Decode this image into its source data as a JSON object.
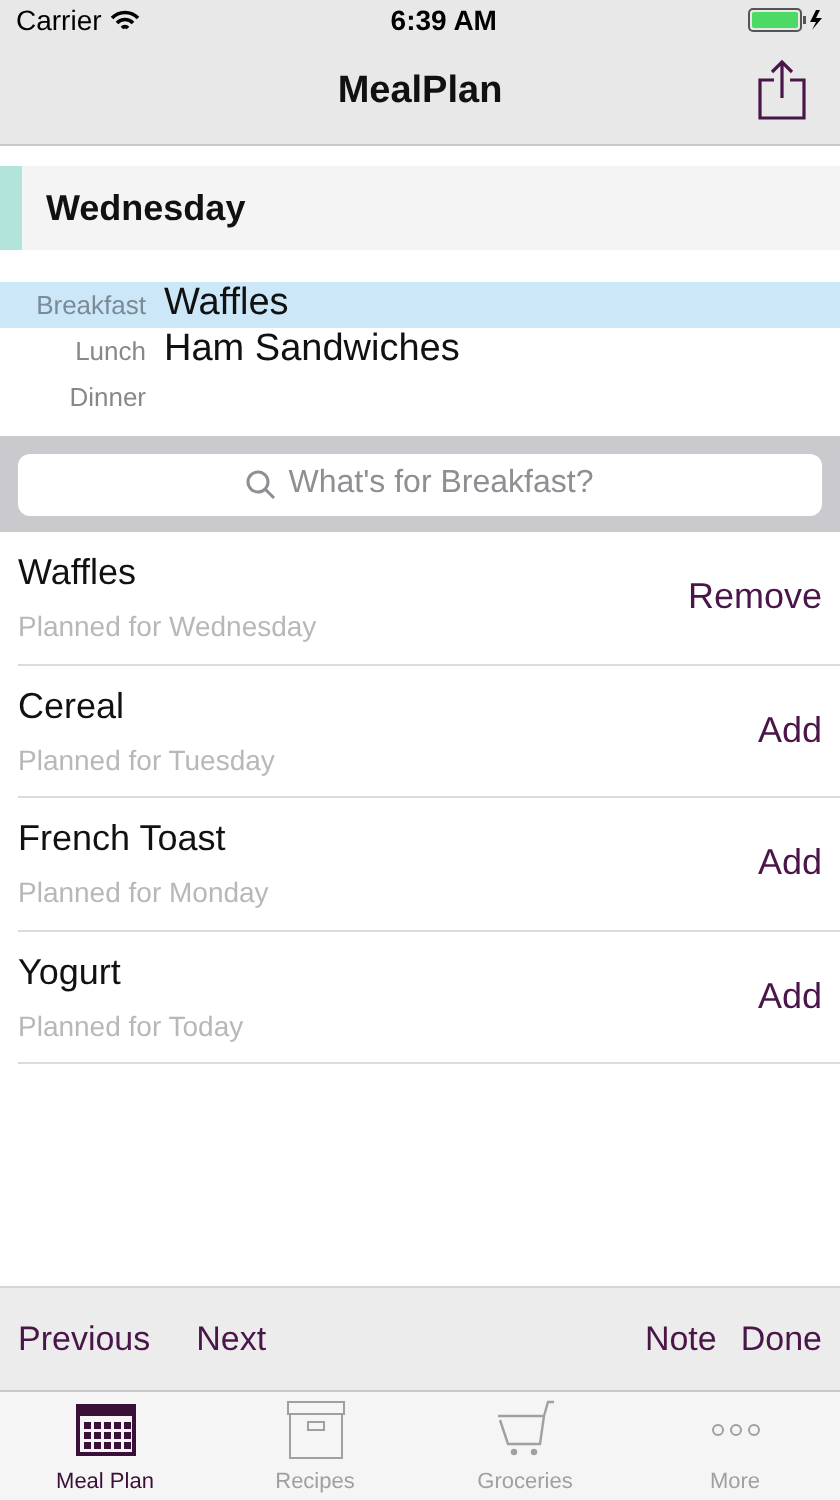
{
  "status_bar": {
    "carrier": "Carrier",
    "time": "6:39 AM"
  },
  "nav": {
    "title": "MealPlan"
  },
  "day": {
    "title": "Wednesday"
  },
  "meals": [
    {
      "label": "Breakfast",
      "value": "Waffles",
      "selected": true
    },
    {
      "label": "Lunch",
      "value": "Ham Sandwiches",
      "selected": false
    },
    {
      "label": "Dinner",
      "selected": false
    }
  ],
  "search": {
    "placeholder": "What's for Breakfast?"
  },
  "items": [
    {
      "name": "Waffles",
      "subtitle": "Planned for Wednesday",
      "action": "Remove"
    },
    {
      "name": "Cereal",
      "subtitle": "Planned for Tuesday",
      "action": "Add"
    },
    {
      "name": "French Toast",
      "subtitle": "Planned for Monday",
      "action": "Add"
    },
    {
      "name": "Yogurt",
      "subtitle": "Planned for Today",
      "action": "Add"
    }
  ],
  "toolbar": {
    "left": [
      "Previous",
      "Next"
    ],
    "right": [
      "Note",
      "Done"
    ]
  },
  "tabs": [
    {
      "label": "Meal Plan",
      "kind": "calendar",
      "selected": true
    },
    {
      "label": "Recipes",
      "kind": "box",
      "selected": false
    },
    {
      "label": "Groceries",
      "kind": "cart",
      "selected": false
    },
    {
      "label": "More",
      "kind": "more",
      "selected": false
    }
  ]
}
